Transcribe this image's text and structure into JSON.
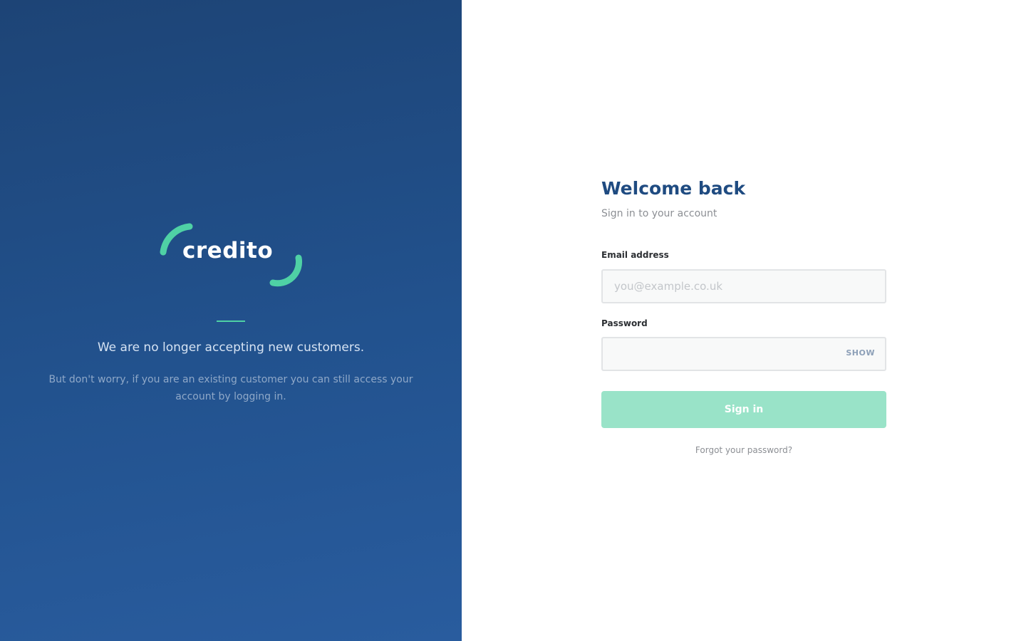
{
  "brand": {
    "logo_text": "credito",
    "accent_color": "#4fd1a5",
    "panel_color": "#22528e"
  },
  "left_panel": {
    "headline": "We are no longer accepting new customers.",
    "subtext": "But don't worry, if you are an existing customer you can still access your account by logging in."
  },
  "form": {
    "title": "Welcome back",
    "subtitle": "Sign in to your account",
    "email_label": "Email address",
    "email_placeholder": "you@example.co.uk",
    "email_value": "",
    "password_label": "Password",
    "password_value": "",
    "show_label": "SHOW",
    "signin_label": "Sign in",
    "forgot_label": "Forgot your password?"
  }
}
